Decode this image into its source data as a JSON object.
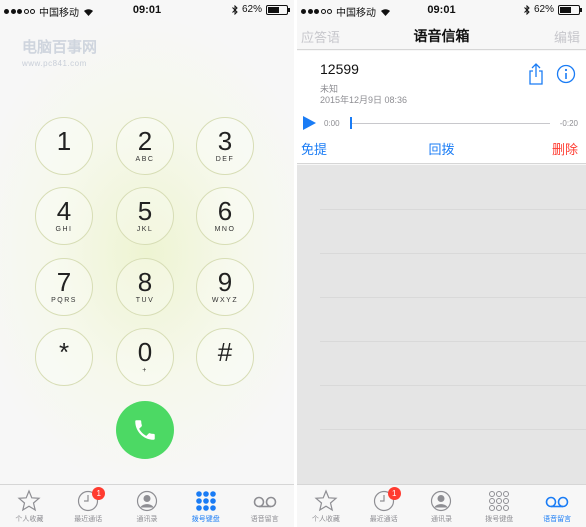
{
  "left_screen": {
    "status_bar": {
      "carrier": "中国移动",
      "time": "09:01",
      "battery": "62%",
      "battery_level": 0.62
    },
    "watermark": {
      "title": "电脑百事网",
      "subtitle": "www.pc841.com"
    },
    "keypad": [
      {
        "digit": "1",
        "letters": ""
      },
      {
        "digit": "2",
        "letters": "ABC"
      },
      {
        "digit": "3",
        "letters": "DEF"
      },
      {
        "digit": "4",
        "letters": "GHI"
      },
      {
        "digit": "5",
        "letters": "JKL"
      },
      {
        "digit": "6",
        "letters": "MNO"
      },
      {
        "digit": "7",
        "letters": "PQRS"
      },
      {
        "digit": "8",
        "letters": "TUV"
      },
      {
        "digit": "9",
        "letters": "WXYZ"
      },
      {
        "digit": "*",
        "letters": ""
      },
      {
        "digit": "0",
        "letters": "+"
      },
      {
        "digit": "#",
        "letters": ""
      }
    ],
    "tabs": [
      {
        "label": "个人收藏",
        "icon": "star-icon",
        "active": false
      },
      {
        "label": "最近通话",
        "icon": "clock-icon",
        "active": false,
        "badge": "1"
      },
      {
        "label": "通讯录",
        "icon": "contacts-icon",
        "active": false
      },
      {
        "label": "拨号键盘",
        "icon": "keypad-icon",
        "active": true
      },
      {
        "label": "语音留言",
        "icon": "voicemail-icon",
        "active": false
      }
    ]
  },
  "right_screen": {
    "status_bar": {
      "carrier": "中国移动",
      "time": "09:01",
      "battery": "62%",
      "battery_level": 0.62
    },
    "nav": {
      "left": "应答语",
      "title": "语音信箱",
      "right": "编辑"
    },
    "voicemail": {
      "number": "12599",
      "label": "未知",
      "date": "2015年12月9日 08:36",
      "time_start": "0:00",
      "time_end": "-0:20",
      "speaker": "免提",
      "callback": "回拨",
      "delete": "删除"
    },
    "tabs": [
      {
        "label": "个人收藏",
        "icon": "star-icon",
        "active": false
      },
      {
        "label": "最近通话",
        "icon": "clock-icon",
        "active": false,
        "badge": "1"
      },
      {
        "label": "通讯录",
        "icon": "contacts-icon",
        "active": false
      },
      {
        "label": "拨号键盘",
        "icon": "keypad-icon",
        "active": false
      },
      {
        "label": "语音留言",
        "icon": "voicemail-icon",
        "active": true
      }
    ]
  },
  "colors": {
    "accent": "#1a7cf5",
    "call_green": "#4cd964",
    "delete_red": "#ff3b30",
    "badge_red": "#ff3b30"
  }
}
